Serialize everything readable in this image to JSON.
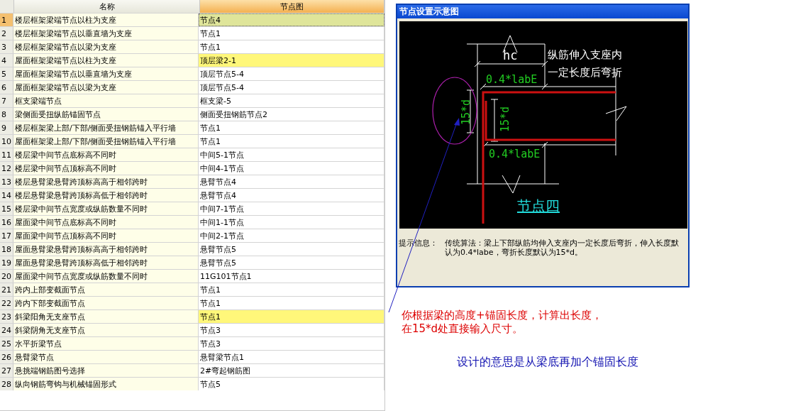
{
  "table": {
    "columns": [
      {
        "label": "名称",
        "selected": false
      },
      {
        "label": "节点图",
        "selected": true
      }
    ],
    "rows": [
      {
        "index": "1",
        "name": "楼层框架梁端节点以柱为支座",
        "node": "节点4",
        "selected": true,
        "highlighted": false
      },
      {
        "index": "2",
        "name": "楼层框架梁端节点以垂直墙为支座",
        "node": "节点1",
        "selected": false,
        "highlighted": false
      },
      {
        "index": "3",
        "name": "楼层框架梁端节点以梁为支座",
        "node": "节点1",
        "selected": false,
        "highlighted": false
      },
      {
        "index": "4",
        "name": "屋面框架梁端节点以柱为支座",
        "node": "顶层梁2-1",
        "selected": false,
        "highlighted": true
      },
      {
        "index": "5",
        "name": "屋面框架梁端节点以垂直墙为支座",
        "node": "顶层节点5-4",
        "selected": false,
        "highlighted": false
      },
      {
        "index": "6",
        "name": "屋面框架梁端节点以梁为支座",
        "node": "顶层节点5-4",
        "selected": false,
        "highlighted": false
      },
      {
        "index": "7",
        "name": "框支梁端节点",
        "node": "框支梁-5",
        "selected": false,
        "highlighted": false
      },
      {
        "index": "8",
        "name": "梁侧面受扭纵筋锚固节点",
        "node": "侧面受扭钢筋节点2",
        "selected": false,
        "highlighted": false
      },
      {
        "index": "9",
        "name": "楼层框架梁上部/下部/侧面受扭钢筋锚入平行墙",
        "node": "节点1",
        "selected": false,
        "highlighted": false
      },
      {
        "index": "10",
        "name": "屋面框架梁上部/下部/侧面受扭钢筋锚入平行墙",
        "node": "节点1",
        "selected": false,
        "highlighted": false
      },
      {
        "index": "11",
        "name": "楼层梁中间节点底标高不同时",
        "node": "中间5-1节点",
        "selected": false,
        "highlighted": false
      },
      {
        "index": "12",
        "name": "楼层梁中间节点顶标高不同时",
        "node": "中间4-1节点",
        "selected": false,
        "highlighted": false
      },
      {
        "index": "13",
        "name": "楼层悬臂梁悬臂跨顶标高高于相邻跨时",
        "node": "悬臂节点4",
        "selected": false,
        "highlighted": false
      },
      {
        "index": "14",
        "name": "楼层悬臂梁悬臂跨顶标高低于相邻跨时",
        "node": "悬臂节点4",
        "selected": false,
        "highlighted": false
      },
      {
        "index": "15",
        "name": "楼层梁中间节点宽度或纵筋数量不同时",
        "node": "中间7-1节点",
        "selected": false,
        "highlighted": false
      },
      {
        "index": "16",
        "name": "屋面梁中间节点底标高不同时",
        "node": "中间1-1节点",
        "selected": false,
        "highlighted": false
      },
      {
        "index": "17",
        "name": "屋面梁中间节点顶标高不同时",
        "node": "中间2-1节点",
        "selected": false,
        "highlighted": false
      },
      {
        "index": "18",
        "name": "屋面悬臂梁悬臂跨顶标高高于相邻跨时",
        "node": "悬臂节点5",
        "selected": false,
        "highlighted": false
      },
      {
        "index": "19",
        "name": "屋面悬臂梁悬臂跨顶标高低于相邻跨时",
        "node": "悬臂节点5",
        "selected": false,
        "highlighted": false
      },
      {
        "index": "20",
        "name": "屋面梁中间节点宽度或纵筋数量不同时",
        "node": "11G101节点1",
        "selected": false,
        "highlighted": false
      },
      {
        "index": "21",
        "name": "跨内上部变截面节点",
        "node": "节点1",
        "selected": false,
        "highlighted": false
      },
      {
        "index": "22",
        "name": "跨内下部变截面节点",
        "node": "节点1",
        "selected": false,
        "highlighted": false
      },
      {
        "index": "23",
        "name": "斜梁阳角无支座节点",
        "node": "节点1",
        "selected": false,
        "highlighted": true
      },
      {
        "index": "24",
        "name": "斜梁阴角无支座节点",
        "node": "节点3",
        "selected": false,
        "highlighted": false
      },
      {
        "index": "25",
        "name": "水平折梁节点",
        "node": "节点3",
        "selected": false,
        "highlighted": false
      },
      {
        "index": "26",
        "name": "悬臂梁节点",
        "node": "悬臂梁节点1",
        "selected": false,
        "highlighted": false
      },
      {
        "index": "27",
        "name": "悬挑端钢筋图号选择",
        "node": "2#弯起钢筋图",
        "selected": false,
        "highlighted": false
      },
      {
        "index": "28",
        "name": "纵向钢筋弯钩与机械锚固形式",
        "node": "节点5",
        "selected": false,
        "highlighted": false
      }
    ]
  },
  "dialog": {
    "title": "节点设置示意图",
    "diagram": {
      "width_label": "hc",
      "note_lines": [
        "纵筋伸入支座内",
        "一定长度后弯折"
      ],
      "top_dimension": "0.4*labE",
      "bottom_dimension": "0.4*labE",
      "outer_bend": "15*d",
      "inner_bend": "15*d",
      "caption": "节点四"
    },
    "hint_label": "提示信息：",
    "hint_text": "传统算法：梁上下部纵筋均伸入支座内一定长度后弯折，伸入长度默认为0.4*labe，弯折长度默认为15*d。"
  },
  "notes": [
    {
      "lines": [
        "你根据梁的高度+锚固长度，计算出长度，",
        "在15*d处直接输入尺寸。"
      ],
      "color": "#dd0000"
    },
    {
      "lines": [
        "设计的意思是从梁底再加个锚固长度"
      ],
      "color": "#1010b0"
    }
  ]
}
